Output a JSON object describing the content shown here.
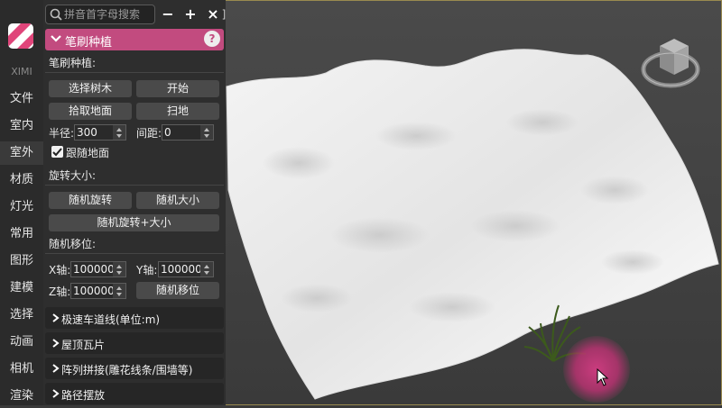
{
  "brand": "XIMI",
  "rail": {
    "items": [
      {
        "label": "文件"
      },
      {
        "label": "室内"
      },
      {
        "label": "室外"
      },
      {
        "label": "材质"
      },
      {
        "label": "灯光"
      },
      {
        "label": "常用"
      },
      {
        "label": "图形"
      },
      {
        "label": "建模"
      },
      {
        "label": "选择"
      },
      {
        "label": "动画"
      },
      {
        "label": "相机"
      },
      {
        "label": "渲染"
      }
    ],
    "active_index": 2
  },
  "search": {
    "placeholder": "拼音首字母搜索"
  },
  "toolbar": {
    "minus": "−",
    "plus": "+",
    "close": "×",
    "bracket": "]"
  },
  "section": {
    "title": "笔刷种植",
    "help": "?",
    "plant_label": "笔刷种植:",
    "buttons": {
      "select_tree": "选择树木",
      "start": "开始",
      "pick_ground": "拾取地面",
      "sweep": "扫地"
    },
    "radius_label": "半径:",
    "radius_value": "300",
    "spacing_label": "间距:",
    "spacing_value": "0",
    "follow_ground": "跟随地面",
    "rotate_size_label": "旋转大小:",
    "random_rotate": "随机旋转",
    "random_size": "随机大小",
    "random_rotate_size": "随机旋转+大小",
    "random_move_label": "随机移位:",
    "x_label": "X轴:",
    "x_value": "100000",
    "y_label": "Y轴:",
    "y_value": "100000",
    "z_label": "Z轴:",
    "z_value": "100000",
    "random_move": "随机移位"
  },
  "collapsed_sections": [
    {
      "title": "极速车道线(单位:m)"
    },
    {
      "title": "屋顶瓦片"
    },
    {
      "title": "阵列拼接(雕花线条/围墙等)"
    },
    {
      "title": "路径摆放"
    }
  ],
  "colors": {
    "accent": "#c24b7f",
    "panel": "#2e2e2e",
    "button": "#4a4a4a"
  }
}
